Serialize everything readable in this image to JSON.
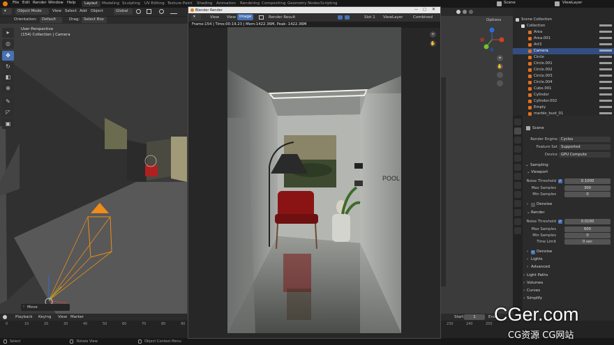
{
  "topbar": {
    "menus": [
      "File",
      "Edit",
      "Render",
      "Window",
      "Help"
    ],
    "workspaces": [
      "Layout",
      "Modeling",
      "Sculpting",
      "UV Editing",
      "Texture Paint",
      "Shading",
      "Animation",
      "Rendering",
      "Compositing",
      "Geometry Nodes",
      "Scripting"
    ],
    "active_workspace": "Layout",
    "scene_name": "Scene",
    "view_layer": "ViewLayer"
  },
  "viewport": {
    "mode": "Object Mode",
    "menus": [
      "View",
      "Select",
      "Add",
      "Object"
    ],
    "orientation_label": "Orientation:",
    "orientation_value": "Default",
    "transform_space": "Global",
    "drag_label": "Drag:",
    "drag_value": "Select Box",
    "overlay_title": "User Perspective",
    "overlay_subtitle": "(154) Collection | Camera",
    "operator_panel": "Move"
  },
  "render_window": {
    "title": "Blender Render",
    "view_menu": "View",
    "view_btn": "View",
    "image_btn": "Image",
    "image_name": "Render Result",
    "slot": "Slot 1",
    "layer": "ViewLayer",
    "pass": "Combined",
    "info": "Frame:154 | Time:00:19.23 | Mem:1422.36M, Peak: 1422.36M",
    "wall_text": "POOL"
  },
  "right_viewport": {
    "options": "Options"
  },
  "outliner": {
    "scene_collection": "Scene Collection",
    "collection": "Collection",
    "items": [
      "Area",
      "Area.001",
      "Art3",
      "Camera",
      "Circle",
      "Circle.001",
      "Circle.002",
      "Circle.003",
      "Circle.004",
      "Cube.001",
      "Cylinder",
      "Cylinder.002",
      "Empty",
      "marble_bust_01"
    ],
    "selected": "Camera"
  },
  "properties": {
    "scene_label": "Scene",
    "render_engine_label": "Render Engine",
    "render_engine": "Cycles",
    "feature_set_label": "Feature Set",
    "feature_set": "Supported",
    "device_label": "Device",
    "device": "GPU Compute",
    "sampling": "Sampling",
    "viewport": "Viewport",
    "noise_threshold_label": "Noise Threshold",
    "viewport_noise": "0.1000",
    "max_samples_label": "Max Samples",
    "viewport_max": "300",
    "min_samples_label": "Min Samples",
    "viewport_min": "0",
    "denoise": "Denoise",
    "render": "Render",
    "render_noise": "0.0100",
    "render_max": "600",
    "render_min": "0",
    "time_limit_label": "Time Limit",
    "time_limit": "0 sec",
    "denoise2": "Denoise",
    "lights": "Lights",
    "advanced": "Advanced",
    "light_paths": "Light Paths",
    "volumes": "Volumes",
    "curves": "Curves",
    "simplify": "Simplify"
  },
  "timeline": {
    "menus": [
      "Playback",
      "Keying",
      "View",
      "Marker"
    ],
    "start_label": "Start",
    "start": "1",
    "end_label": "End",
    "ticks_left": [
      "0",
      "10",
      "20",
      "30",
      "40",
      "50",
      "60",
      "70",
      "80",
      "90"
    ],
    "ticks_right": [
      "230",
      "240",
      "250"
    ]
  },
  "statusbar": {
    "select": "Select",
    "rotate": "Rotate View",
    "context": "Object Context Menu"
  },
  "watermark": {
    "main": "CGer.com",
    "sub": "CG资源 CG网站"
  }
}
